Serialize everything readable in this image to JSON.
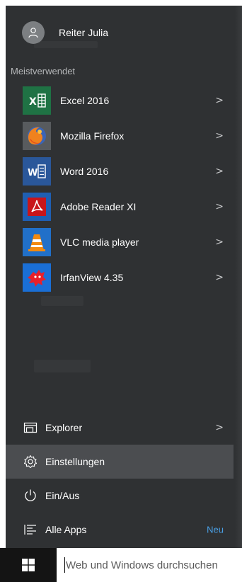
{
  "user": {
    "name": "Reiter Julia"
  },
  "most_used_header": "Meistverwendet",
  "apps": [
    {
      "label": "Excel 2016",
      "icon": "excel-icon",
      "color": "#1f7244"
    },
    {
      "label": "Mozilla Firefox",
      "icon": "firefox-icon",
      "color": "#585b5e"
    },
    {
      "label": "Word 2016",
      "icon": "word-icon",
      "color": "#2a579a"
    },
    {
      "label": "Adobe Reader XI",
      "icon": "adobe-reader-icon",
      "color": "#1f5fb3"
    },
    {
      "label": "VLC media player",
      "icon": "vlc-icon",
      "color": "#2170c9"
    },
    {
      "label": "IrfanView 4.35",
      "icon": "irfanview-icon",
      "color": "#1a6fd6"
    }
  ],
  "bottom": {
    "explorer": "Explorer",
    "settings": "Einstellungen",
    "power": "Ein/Aus",
    "all_apps": "Alle Apps",
    "new_badge": "Neu"
  },
  "taskbar": {
    "search_placeholder": "Web und Windows durchsuchen"
  },
  "colors": {
    "menu_bg": "#2f3133",
    "highlight": "#4b4d50",
    "accent": "#4aa0e6",
    "taskbar": "#141414"
  }
}
